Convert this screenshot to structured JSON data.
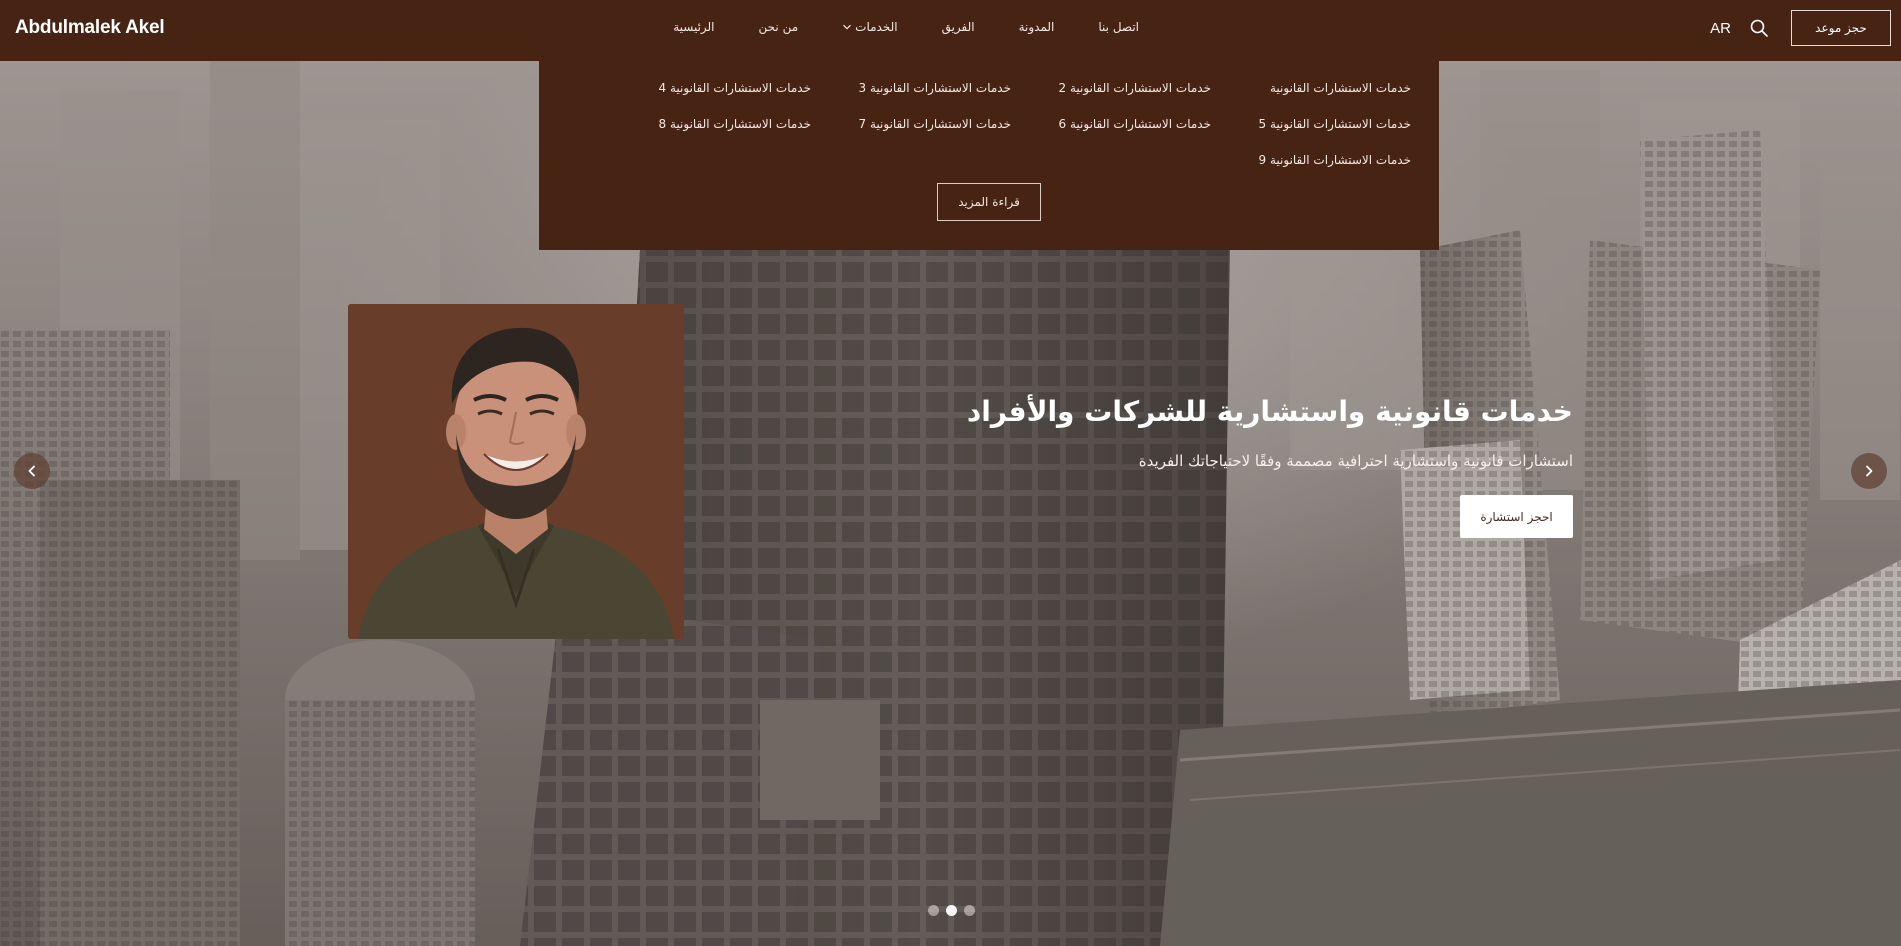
{
  "brand": "Abdulmalek Akel",
  "nav": {
    "items": [
      {
        "id": "home",
        "label": "الرئيسية"
      },
      {
        "id": "about",
        "label": "من نحن"
      },
      {
        "id": "services",
        "label": "الخدمات",
        "has_dropdown": true
      },
      {
        "id": "team",
        "label": "الفريق"
      },
      {
        "id": "blog",
        "label": "المدونة"
      },
      {
        "id": "contact",
        "label": "اتصل بنا"
      }
    ],
    "lang": "AR",
    "book_label": "حجز موعد",
    "search_icon": "search-icon"
  },
  "services_menu": {
    "links": [
      "خدمات الاستشارات القانونية",
      "خدمات الاستشارات القانونية 2",
      "خدمات الاستشارات القانونية 3",
      "خدمات الاستشارات القانونية 4",
      "خدمات الاستشارات القانونية 5",
      "خدمات الاستشارات القانونية 6",
      "خدمات الاستشارات القانونية 7",
      "خدمات الاستشارات القانونية 8",
      "خدمات الاستشارات القانونية 9"
    ],
    "more_label": "قراءة المزيد"
  },
  "hero": {
    "title": "خدمات قانونية واستشارية للشركات والأفراد",
    "subtitle": "استشارات قانونية واستشارية احترافية مصممة وفقًا لاحتياجاتك الفريدة",
    "cta_label": "احجز استشارة",
    "slides_total": 3,
    "active_slide": 2
  },
  "colors": {
    "header_bg": "#472314",
    "portrait_bg": "#683d29",
    "text_light": "#ffffff"
  }
}
